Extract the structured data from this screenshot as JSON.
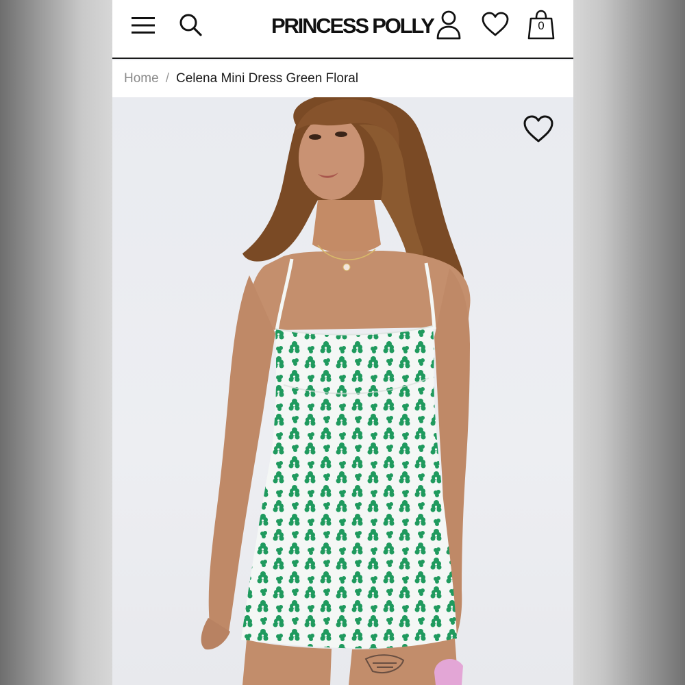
{
  "header": {
    "brand": "PRINCESS POLLY",
    "cart_count": "0",
    "icons": [
      "menu-icon",
      "search-icon",
      "account-icon",
      "wishlist-icon",
      "bag-icon"
    ]
  },
  "breadcrumb": {
    "home": "Home",
    "separator": "/",
    "current": "Celena Mini Dress Green Floral"
  },
  "product": {
    "image_icon": "wishlist-heart-icon"
  },
  "colors": {
    "dress_print": "#1f9a5e",
    "dress_base": "#f4f7f5",
    "text_dark": "#1a1a1a",
    "text_muted": "#8a8a8a"
  }
}
